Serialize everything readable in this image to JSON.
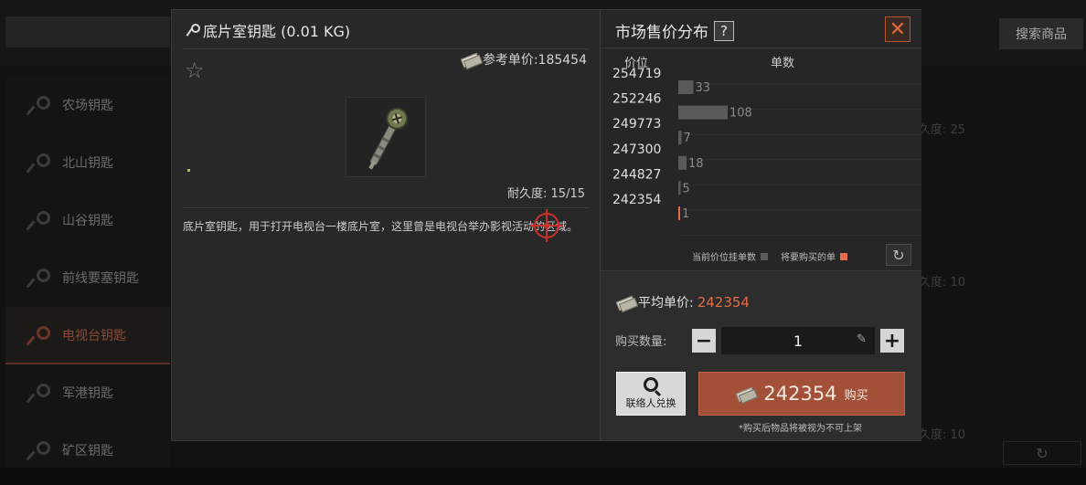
{
  "background": {
    "search_button": "搜索商品",
    "list_items": [
      {
        "label": "农场钥匙",
        "active": false
      },
      {
        "label": "北山钥匙",
        "active": false
      },
      {
        "label": "山谷钥匙",
        "active": false
      },
      {
        "label": "前线要塞钥匙",
        "active": false
      },
      {
        "label": "电视台钥匙",
        "active": true
      },
      {
        "label": "军港钥匙",
        "active": false
      },
      {
        "label": "矿区钥匙",
        "active": false
      }
    ],
    "right_durability": [
      "久度: 25",
      "久度: 10",
      "久度: 10"
    ],
    "refresh_glyph": "↻"
  },
  "item": {
    "title": "底片室钥匙 (0.01 KG)",
    "ref_price_label": "参考单价:185454",
    "durability": "耐久度: 15/15",
    "description": "底片室钥匙，用于打开电视台一楼底片室，这里曾是电视台举办影视活动的区域。",
    "favorite_glyph": "☆"
  },
  "market": {
    "title": "市场售价分布",
    "help_glyph": "?",
    "close_glyph": "✕",
    "col_price": "价位",
    "col_qty": "单数",
    "legend_current": "当前价位挂单数",
    "legend_buy": "将要购买的单",
    "refresh_glyph": "↻",
    "colors": {
      "current": "#5a5a5a",
      "buy": "#e06d45"
    }
  },
  "chart_data": {
    "type": "bar",
    "orientation": "horizontal",
    "categories": [
      "254719",
      "252246",
      "249773",
      "247300",
      "244827",
      "242354"
    ],
    "series": [
      {
        "name": "当前价位挂单数",
        "values": [
          33,
          108,
          7,
          18,
          5,
          1
        ]
      }
    ],
    "highlight": {
      "category": "242354",
      "name": "将要购买的单"
    },
    "xlabel": "单数",
    "ylabel": "价位"
  },
  "purchase": {
    "avg_label": "平均单价:",
    "avg_value": "242354",
    "qty_label": "购买数量:",
    "qty_value": "1",
    "minus_glyph": "−",
    "plus_glyph": "+",
    "pencil_glyph": "✎",
    "contact_label": "联络人兑换",
    "buy_price": "242354",
    "buy_label": "购买",
    "note": "*购买后物品将被视为不可上架"
  }
}
